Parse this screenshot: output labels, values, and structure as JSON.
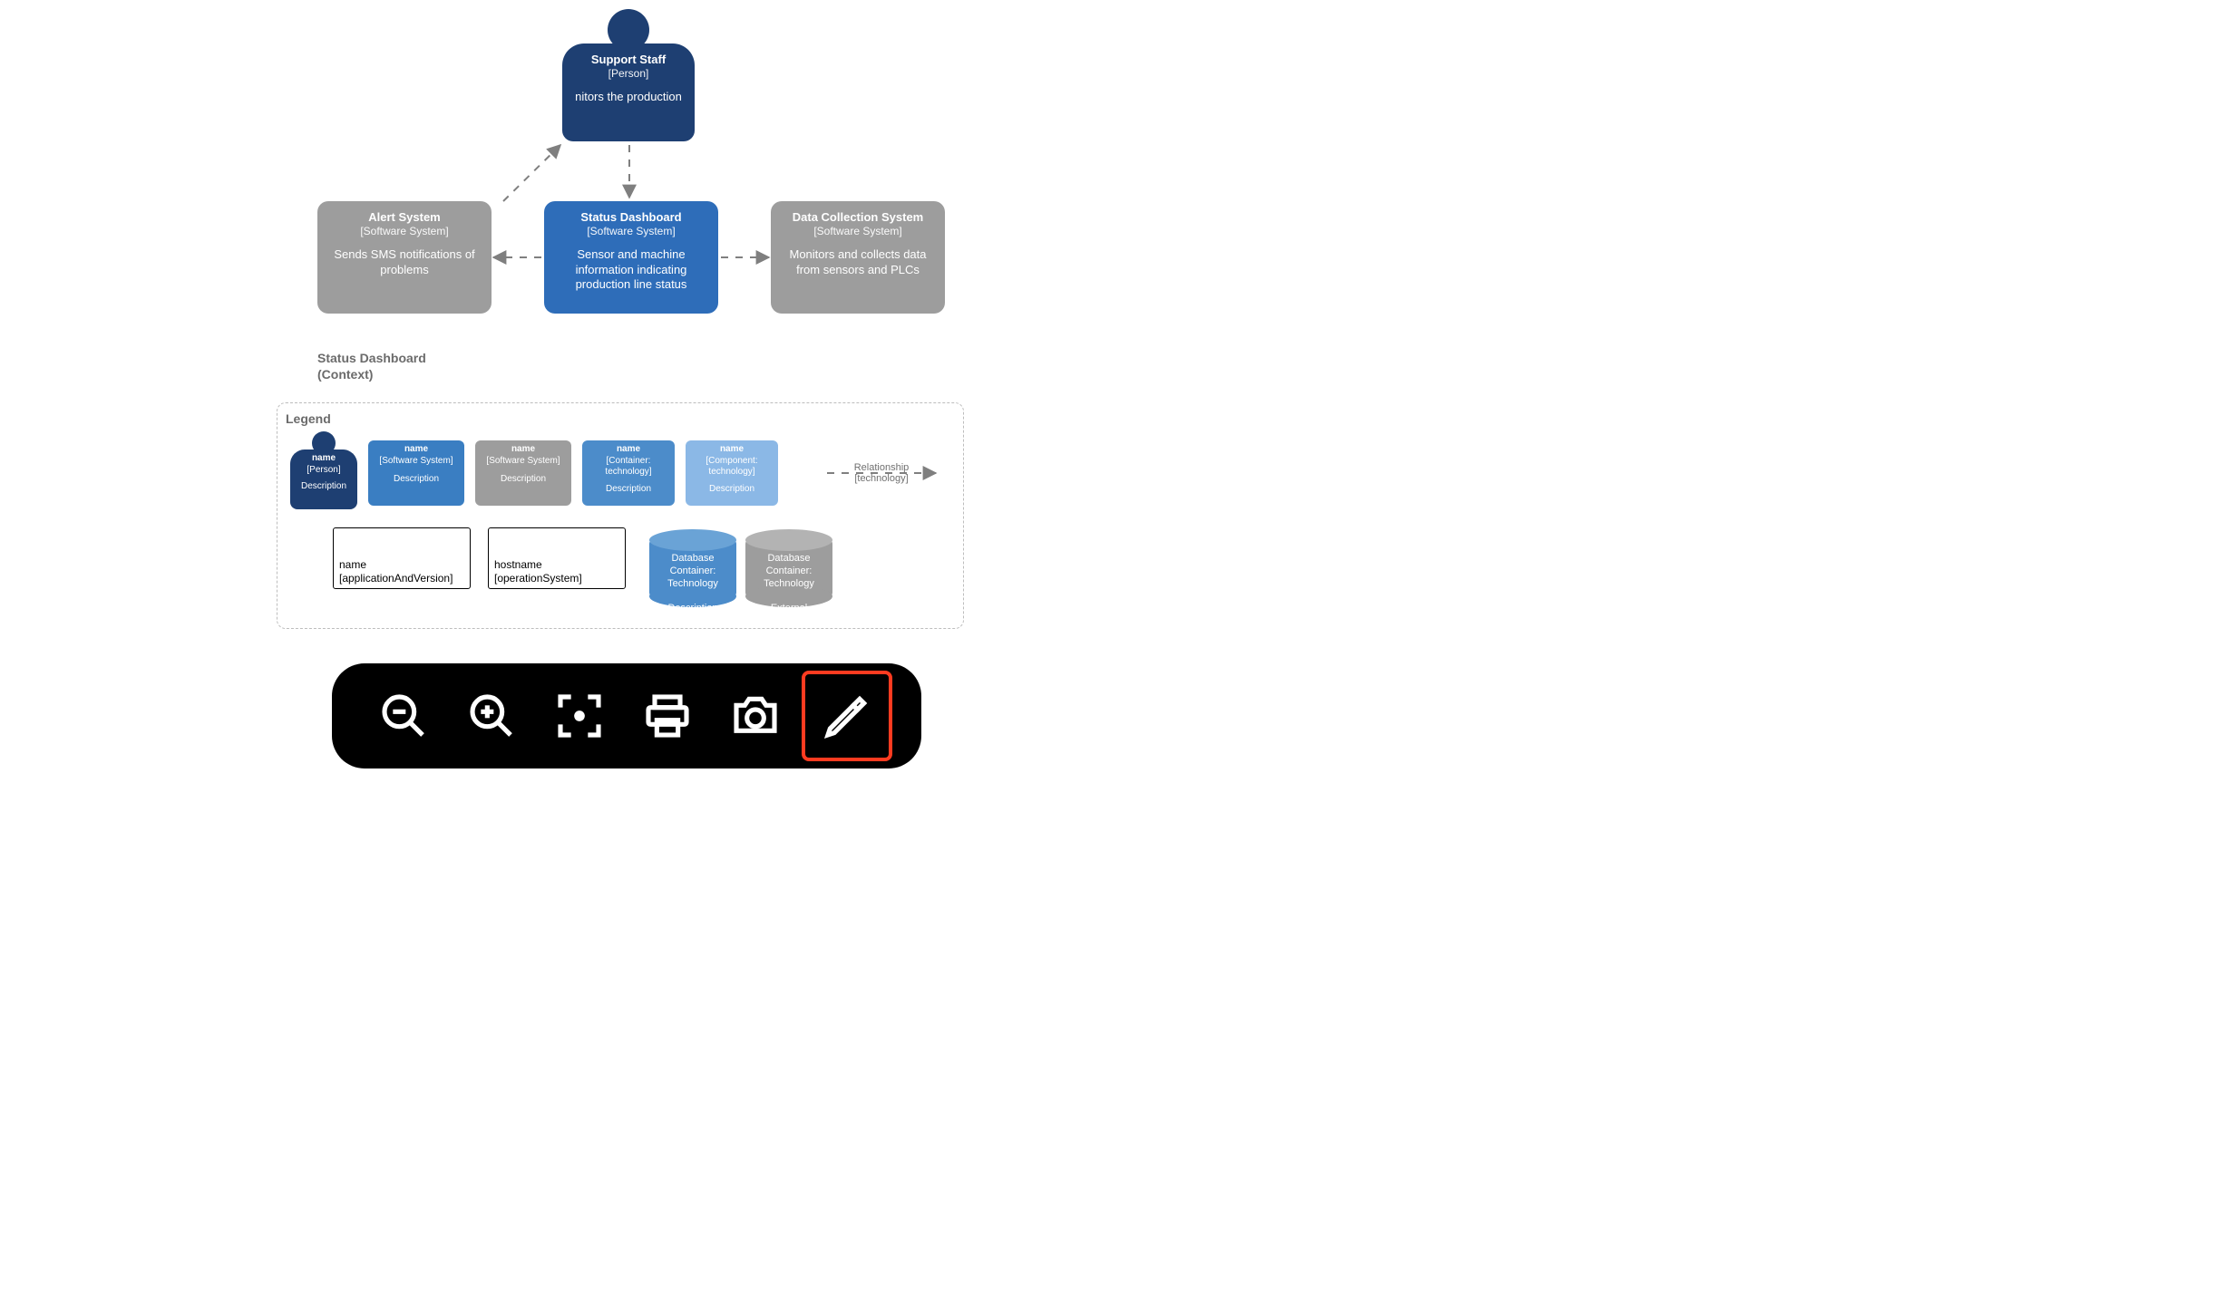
{
  "diagram": {
    "caption_line1": "Status Dashboard",
    "caption_line2": "(Context)",
    "actor": {
      "title": "Support Staff",
      "subtype": "[Person]",
      "desc": "nitors the production"
    },
    "status_dashboard": {
      "title": "Status Dashboard",
      "subtype": "[Software System]",
      "desc": "Sensor and machine information indicating production line status"
    },
    "alert_system": {
      "title": "Alert System",
      "subtype": "[Software System]",
      "desc": "Sends SMS notifications of problems"
    },
    "data_collection": {
      "title": "Data Collection System",
      "subtype": "[Software System]",
      "desc": "Monitors and collects data from sensors and PLCs"
    }
  },
  "legend": {
    "title": "Legend",
    "person": {
      "name": "name",
      "subtype": "[Person]",
      "desc": "Description"
    },
    "softint": {
      "name": "name",
      "subtype": "[Software System]",
      "desc": "Description"
    },
    "softext": {
      "name": "name",
      "subtype": "[Software System]",
      "desc": "Description"
    },
    "container": {
      "name": "name",
      "subtype": "[Container: technology]",
      "desc": "Description"
    },
    "component": {
      "name": "name",
      "subtype": "[Component: technology]",
      "desc": "Description"
    },
    "rel": {
      "label": "Relationship",
      "tech": "[technology]"
    },
    "app": {
      "l1": "name",
      "l2": "[applicationAndVersion]"
    },
    "host": {
      "l1": "hostname",
      "l2": "[operationSystem]"
    },
    "db1": {
      "name": "Database",
      "subtype": "Container: Technology",
      "desc": "Description"
    },
    "db2": {
      "name": "Database",
      "subtype": "Container: Technology",
      "desc": "External"
    }
  },
  "toolbar": {
    "zoom_out": "zoom-out",
    "zoom_in": "zoom-in",
    "fit": "zoom-fit",
    "print": "print",
    "snapshot": "camera",
    "edit": "pencil"
  }
}
